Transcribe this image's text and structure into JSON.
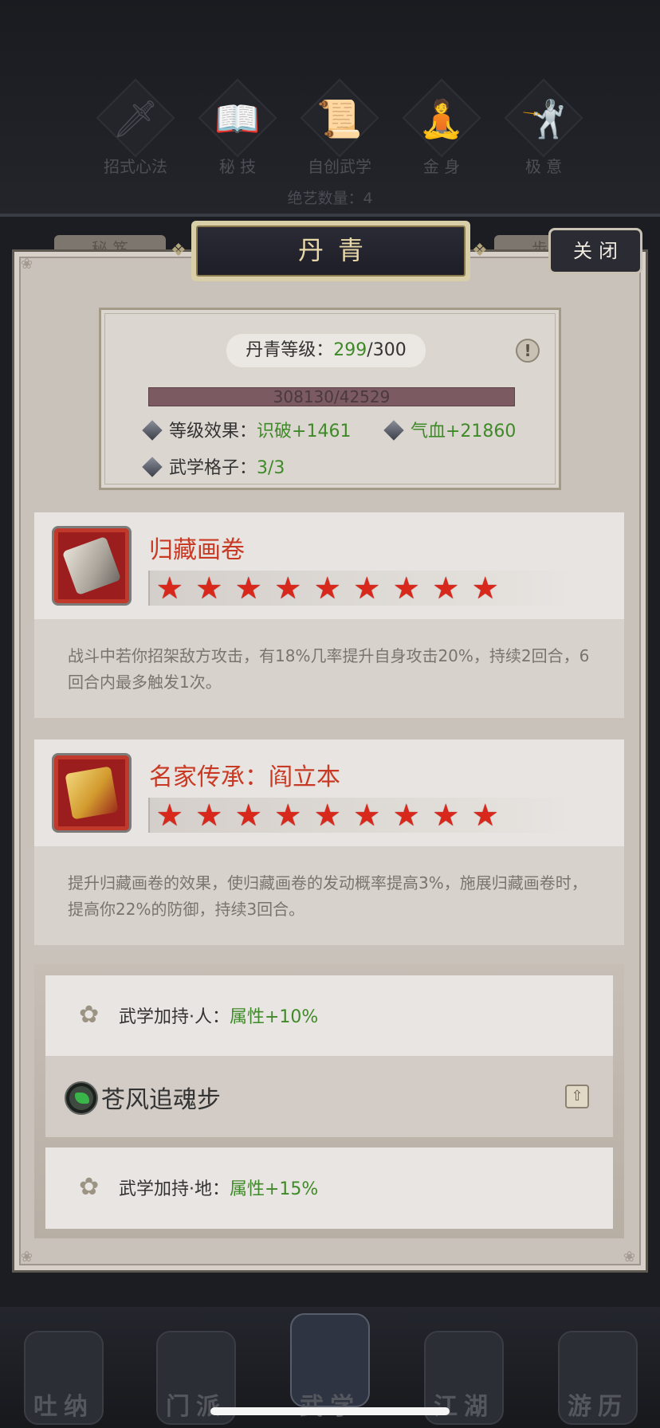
{
  "categories": [
    {
      "label": "招式心法",
      "icon": "sword-icon",
      "glyph": "🗡"
    },
    {
      "label": "秘 技",
      "icon": "book-icon",
      "glyph": "📖"
    },
    {
      "label": "自创武学",
      "icon": "scroll-icon",
      "glyph": "📜"
    },
    {
      "label": "金 身",
      "icon": "meditation-icon",
      "glyph": "🧘"
    },
    {
      "label": "极 意",
      "icon": "martial-pose-icon",
      "glyph": "🤺"
    }
  ],
  "skill_count_text": "绝艺数量：4",
  "faint_tabs": [
    "秘 笈",
    "步 法"
  ],
  "title": "丹青",
  "close_label": "关闭",
  "level": {
    "label": "丹青等级：",
    "current": "299",
    "max": "/300",
    "exp_text": "308130/42529",
    "effect_label": "等级效果：",
    "effect_1": "识破+1461",
    "effect_2": "气血+21860",
    "slots_label": "武学格子：",
    "slots_value": "3/3"
  },
  "cards": [
    {
      "name": "归藏画卷",
      "icon": "scroll-painting-icon",
      "stars": 9,
      "desc": "战斗中若你招架敌方攻击，有18%几率提升自身攻击20%，持续2回合，6回合内最多触发1次。"
    },
    {
      "name": "名家传承：阎立本",
      "icon": "inheritance-scroll-icon",
      "stars": 9,
      "desc": "提升归藏画卷的效果，使归藏画卷的发动概率提高3%，施展归藏画卷时，提高你22%的防御，持续3回合。"
    }
  ],
  "bonus": {
    "ren_label": "武学加持·人：",
    "ren_value": "属性+10%",
    "skill_name": "苍风追魂步",
    "di_label": "武学加持·地：",
    "di_value": "属性+15%"
  },
  "nav": [
    {
      "label": "吐纳",
      "icon": "monk-icon"
    },
    {
      "label": "门派",
      "icon": "sect-icon"
    },
    {
      "label": "武学",
      "icon": "martial-books-icon"
    },
    {
      "label": "江湖",
      "icon": "hat-icon"
    },
    {
      "label": "游历",
      "icon": "horse-icon"
    }
  ],
  "colors": {
    "accent_red": "#c93a24",
    "value_green": "#3f8a28",
    "star_red": "#d8281c"
  }
}
